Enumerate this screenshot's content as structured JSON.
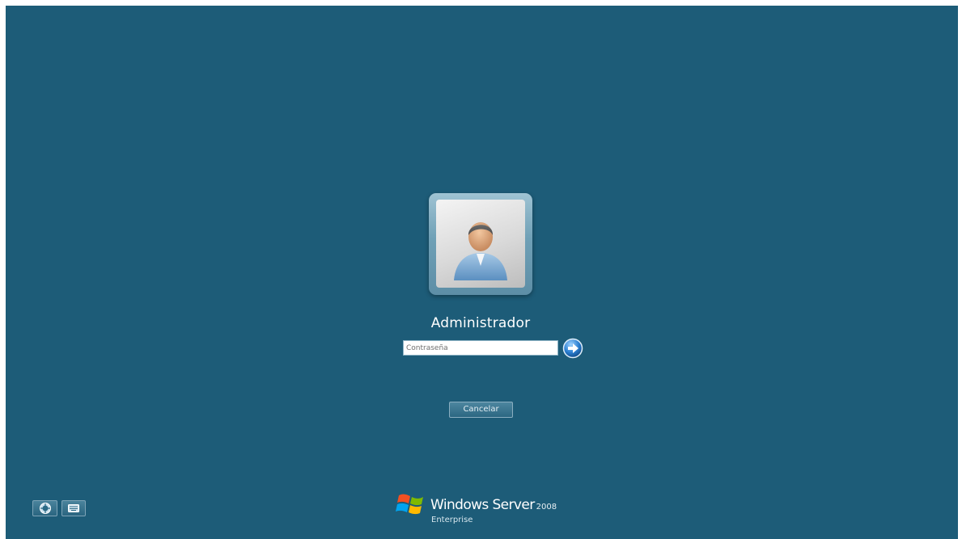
{
  "user": {
    "name": "Administrador",
    "avatar_icon": "user-avatar-icon"
  },
  "login": {
    "password_placeholder": "Contraseña",
    "password_value": "",
    "submit_icon": "arrow-right-icon",
    "cancel_label": "Cancelar"
  },
  "corner_buttons": {
    "ease_of_access_icon": "ease-of-access-icon",
    "keyboard_icon": "keyboard-icon"
  },
  "branding": {
    "product_name": "Windows Server",
    "version": "2008",
    "edition": "Enterprise",
    "logo_icon": "windows-flag-icon"
  },
  "colors": {
    "background": "#1d5c78",
    "tile_frame": "#6fa0b6",
    "text": "#ffffff"
  }
}
